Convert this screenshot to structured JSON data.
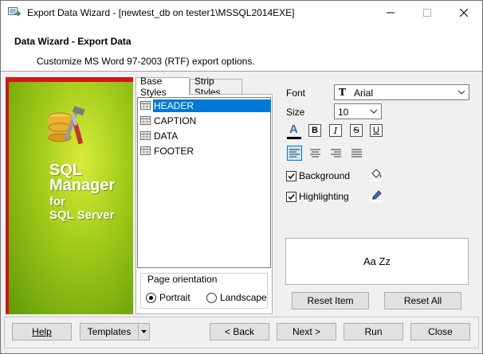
{
  "window": {
    "title": "Export Data Wizard - [newtest_db on tester1\\MSSQL2014EXE]"
  },
  "header": {
    "title": "Data Wizard - Export Data",
    "subtitle": "Customize MS Word 97-2003 (RTF) export options."
  },
  "banner": {
    "line1": "SQL",
    "line2": "Manager",
    "line3": "for",
    "line4": "SQL Server"
  },
  "tabs": [
    {
      "label": "Base Styles",
      "active": true
    },
    {
      "label": "Strip Styles",
      "active": false
    }
  ],
  "style_items": [
    {
      "label": "HEADER",
      "selected": true
    },
    {
      "label": "CAPTION",
      "selected": false
    },
    {
      "label": "DATA",
      "selected": false
    },
    {
      "label": "FOOTER",
      "selected": false
    }
  ],
  "orientation": {
    "title": "Page orientation",
    "options": [
      {
        "label": "Portrait",
        "selected": true
      },
      {
        "label": "Landscape",
        "selected": false
      }
    ]
  },
  "font": {
    "label": "Font",
    "value": "Arial",
    "size_label": "Size",
    "size_value": "10",
    "bold": "B",
    "italic": "I",
    "strike": "S",
    "underline": "U",
    "font_color_glyph": "A",
    "font_color": "#000000"
  },
  "alignment": {
    "options": [
      "align-left",
      "align-center",
      "align-right",
      "align-justify"
    ],
    "selected": "align-left"
  },
  "options": {
    "background_label": "Background",
    "background_checked": true,
    "highlighting_label": "Highlighting",
    "highlighting_checked": true
  },
  "preview": {
    "text": "Aa Zz"
  },
  "buttons": {
    "reset_item": "Reset Item",
    "reset_all": "Reset All",
    "help": "Help",
    "templates": "Templates",
    "back": "< Back",
    "next": "Next >",
    "run": "Run",
    "close": "Close"
  },
  "colors": {
    "selection": "#0078d7",
    "banner_green": "#a9cf1e",
    "banner_red": "#d1151b"
  }
}
